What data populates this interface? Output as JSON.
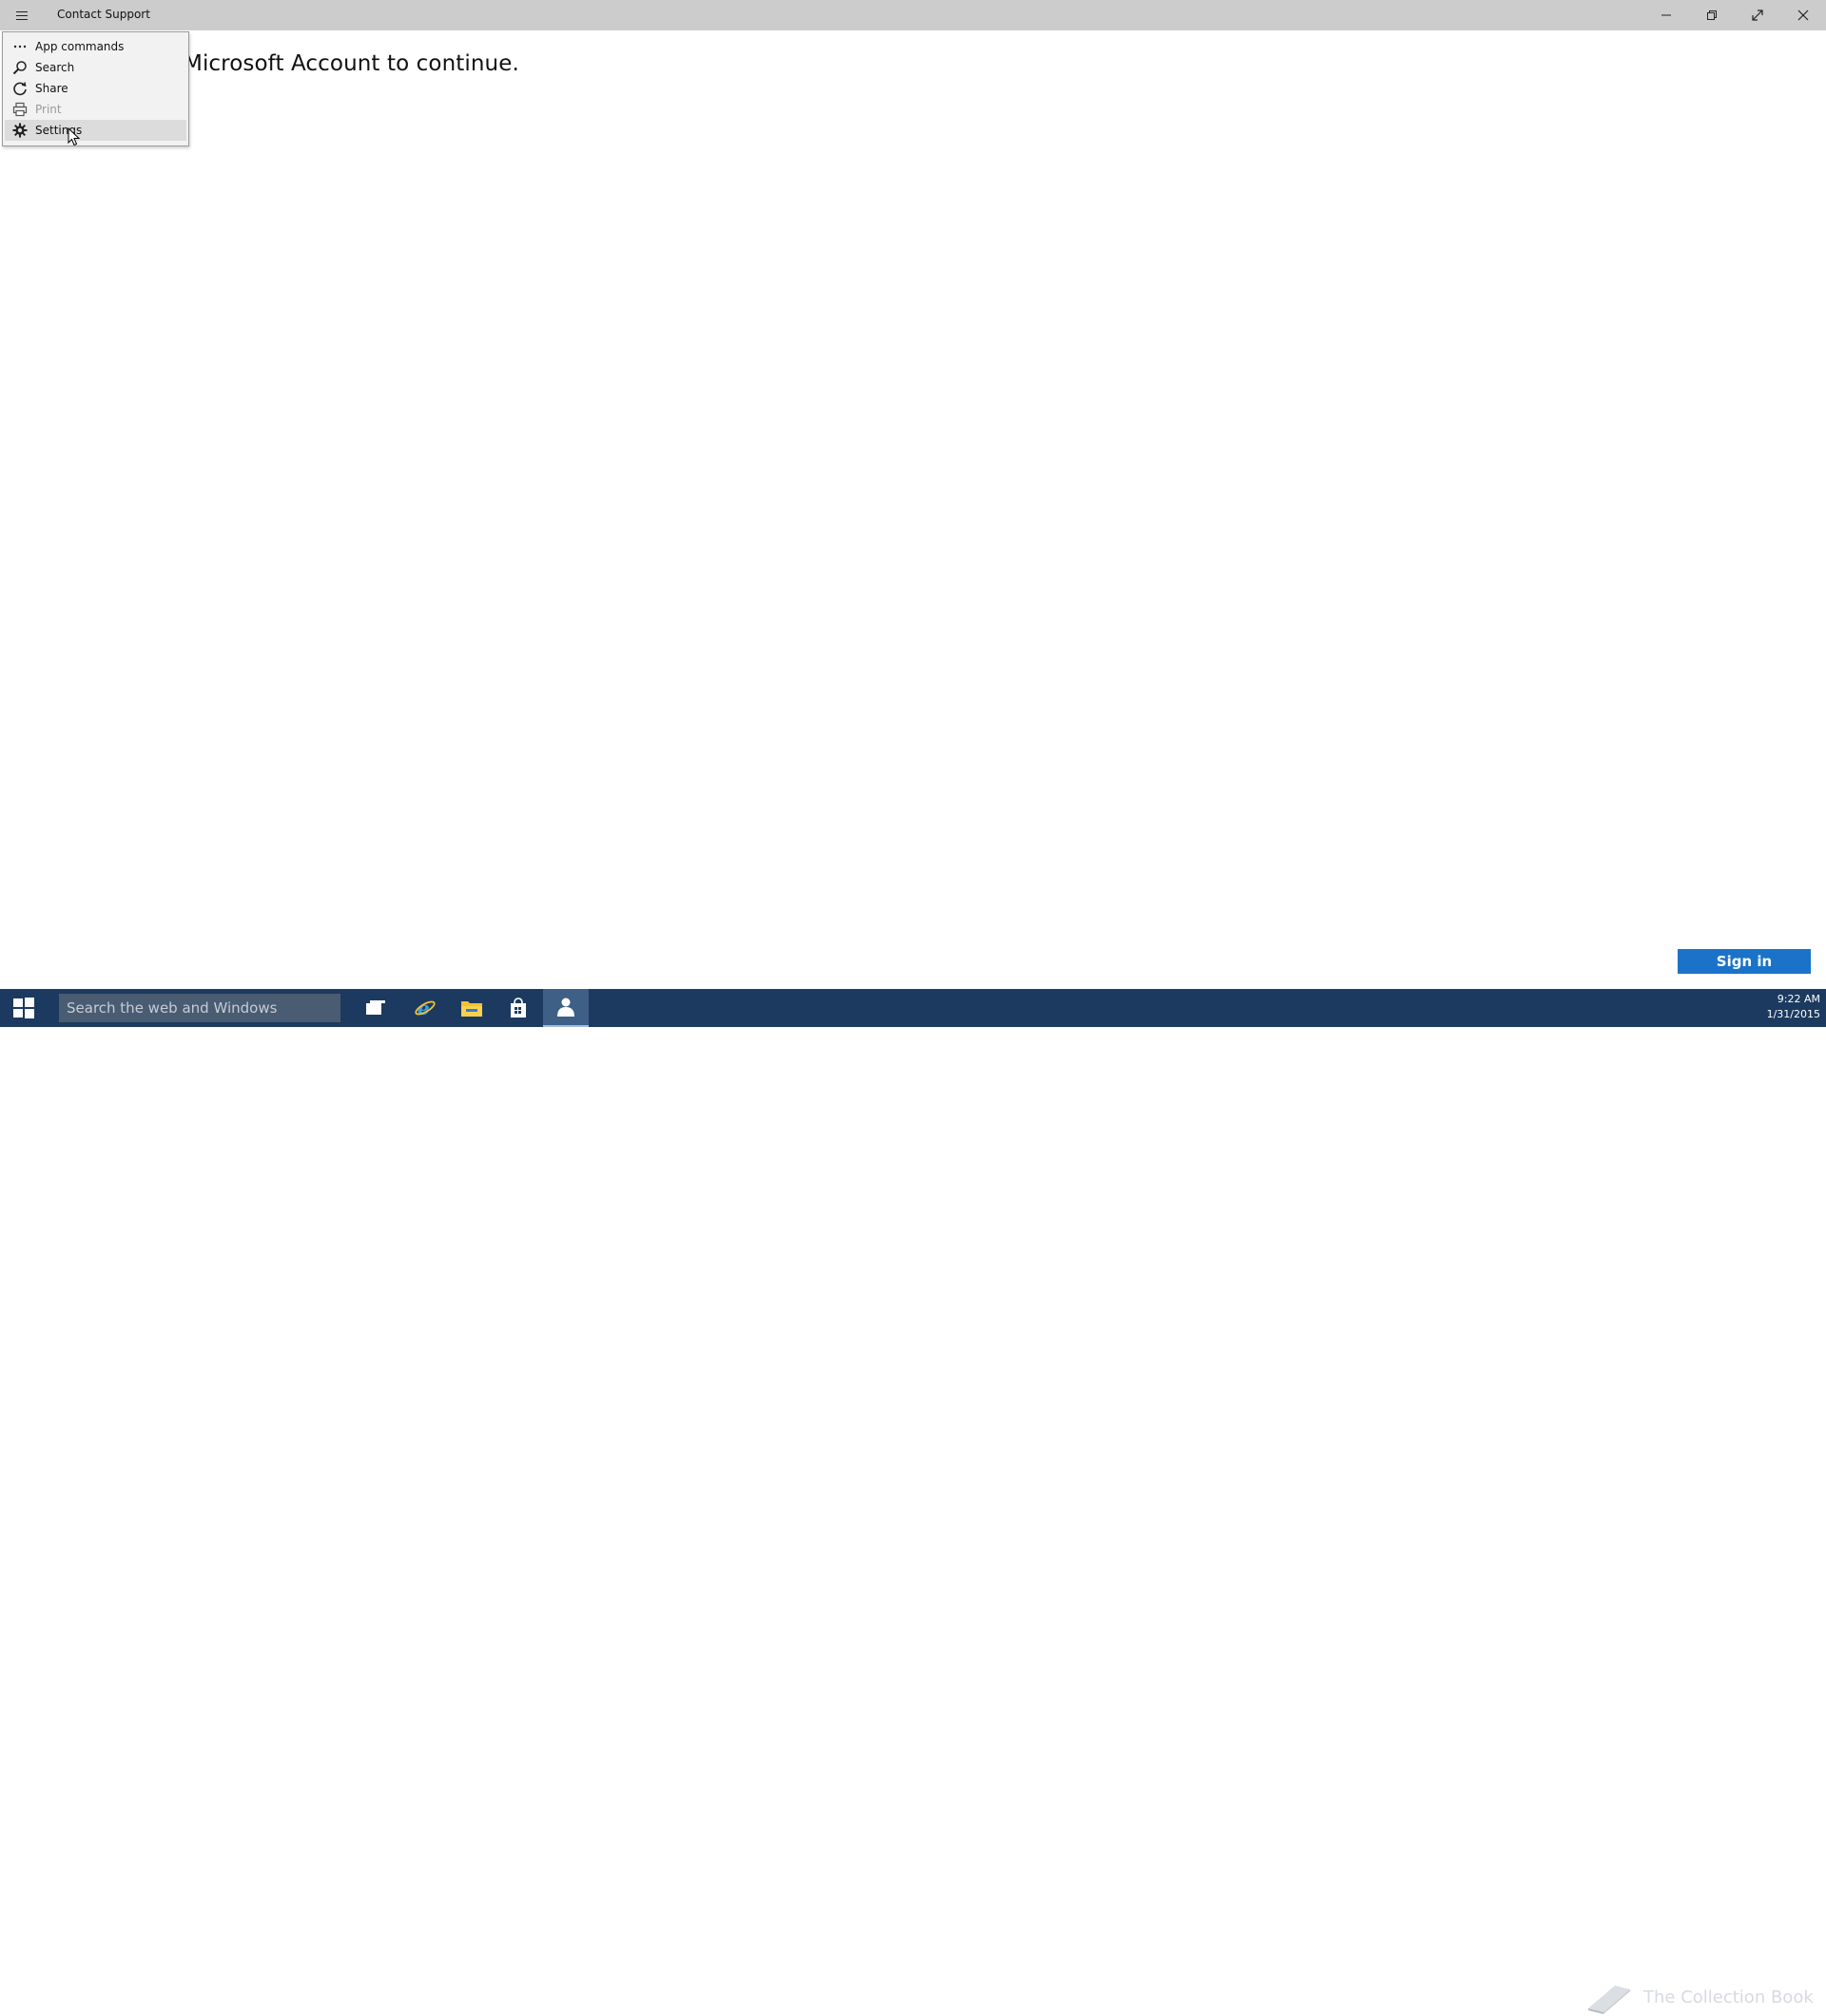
{
  "window": {
    "title": "Contact Support"
  },
  "main": {
    "message": "Microsoft Account to continue."
  },
  "menu": {
    "items": [
      {
        "label": "App commands",
        "icon": "more-icon",
        "disabled": false
      },
      {
        "label": "Search",
        "icon": "search-icon",
        "disabled": false
      },
      {
        "label": "Share",
        "icon": "share-icon",
        "disabled": false
      },
      {
        "label": "Print",
        "icon": "print-icon",
        "disabled": true
      },
      {
        "label": "Settings",
        "icon": "gear-icon",
        "disabled": false,
        "hovered": true
      }
    ]
  },
  "signin": {
    "label": "Sign in"
  },
  "taskbar": {
    "search_placeholder": "Search the web and Windows",
    "apps": [
      "task-view-icon",
      "internet-explorer-icon",
      "file-explorer-icon",
      "store-icon",
      "contact-support-icon"
    ],
    "watermark": "The Collection Book"
  },
  "clock": {
    "time": "9:22 AM",
    "date": "1/31/2015"
  },
  "colors": {
    "titlebar": "#cccccc",
    "taskbar": "#1c3a5f",
    "accent": "#1a73c9"
  }
}
